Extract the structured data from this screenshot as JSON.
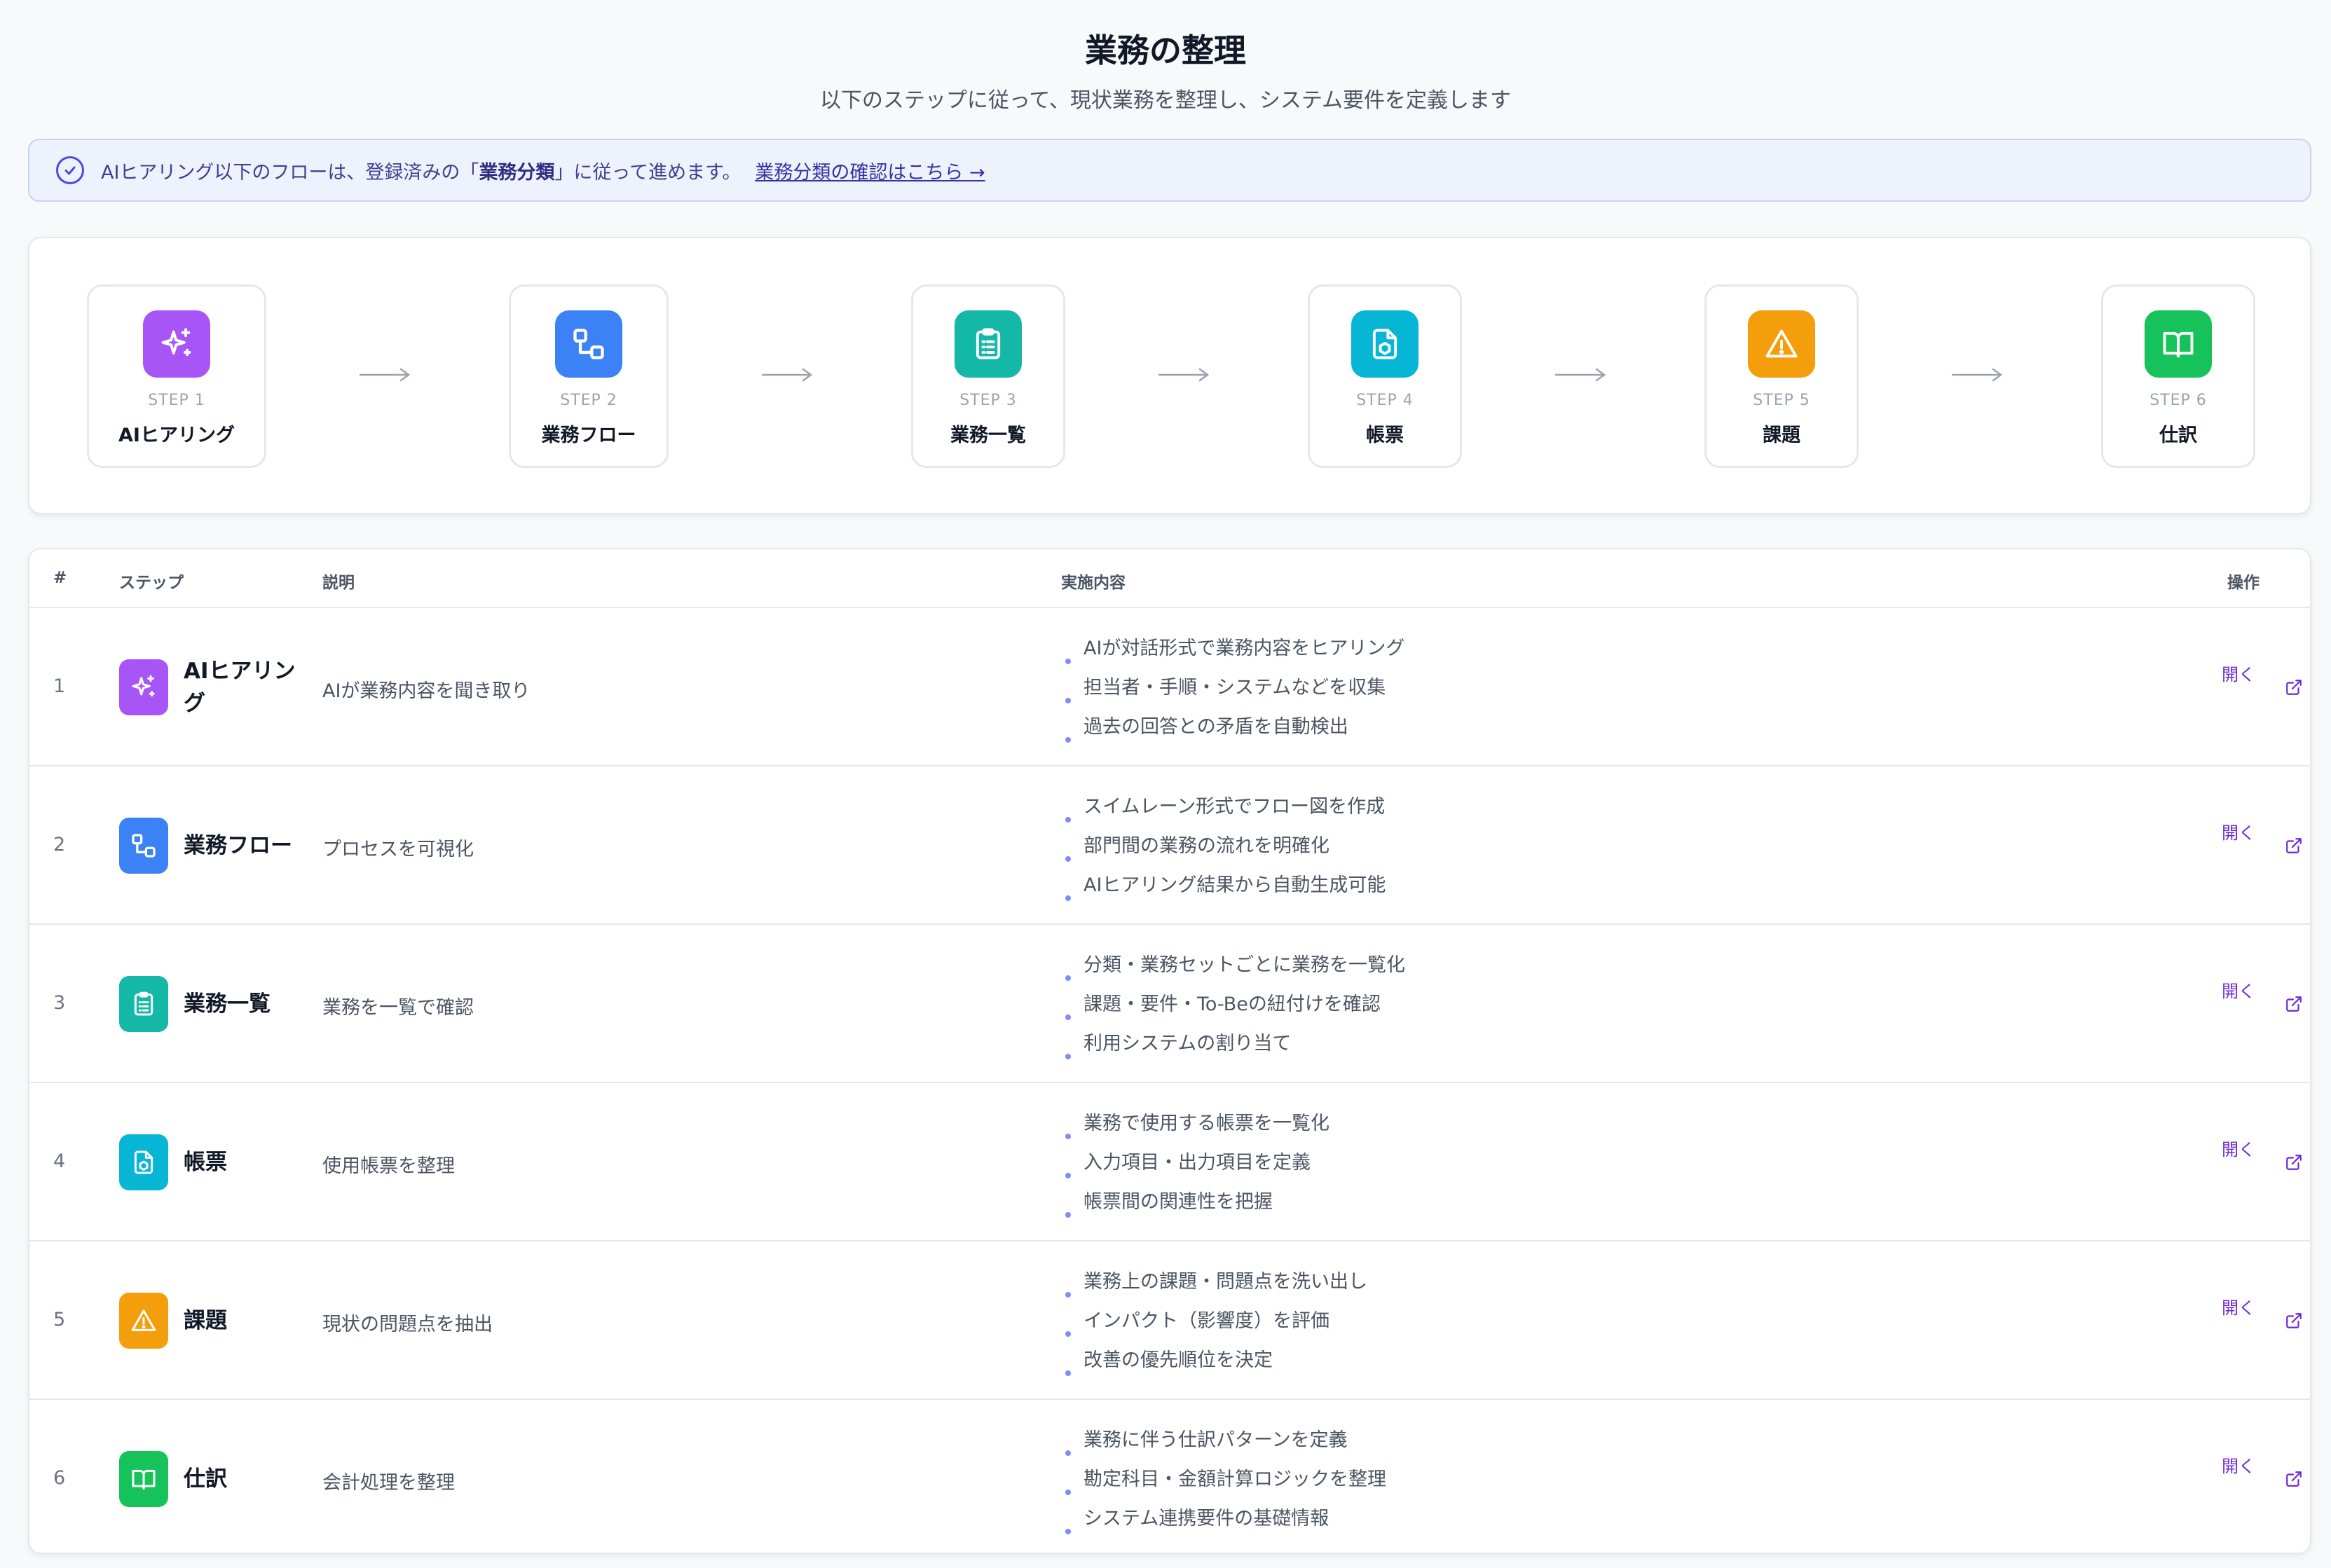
{
  "header": {
    "title": "業務の整理",
    "subtitle": "以下のステップに従って、現状業務を整理し、システム要件を定義します"
  },
  "notice": {
    "icon": "check-circle-icon",
    "text_before": "AIヒアリング以下のフローは、登録済みの「",
    "text_strong": "業務分類",
    "text_after": "」に従って進めます。",
    "link_label": "業務分類の確認はこちら →"
  },
  "steps": [
    {
      "num": "STEP 1",
      "name": "AIヒアリング",
      "icon": "sparkles-icon",
      "color": "#a855f7"
    },
    {
      "num": "STEP 2",
      "name": "業務フロー",
      "icon": "flow-icon",
      "color": "#3b82f6"
    },
    {
      "num": "STEP 3",
      "name": "業務一覧",
      "icon": "clipboard-list-icon",
      "color": "#14b8a6"
    },
    {
      "num": "STEP 4",
      "name": "帳票",
      "icon": "document-box-icon",
      "color": "#06b6d4"
    },
    {
      "num": "STEP 5",
      "name": "課題",
      "icon": "warning-icon",
      "color": "#f59e0b"
    },
    {
      "num": "STEP 6",
      "name": "仕訳",
      "icon": "book-open-icon",
      "color": "#16c25a"
    }
  ],
  "table": {
    "headers": {
      "num": "#",
      "step": "ステップ",
      "desc": "説明",
      "content": "実施内容",
      "action": "操作"
    },
    "rows": [
      {
        "num": "1",
        "name": "AIヒアリング",
        "desc": "AIが業務内容を聞き取り",
        "items": [
          "AIが対話形式で業務内容をヒアリング",
          "担当者・手順・システムなどを収集",
          "過去の回答との矛盾を自動検出"
        ],
        "action": "開く"
      },
      {
        "num": "2",
        "name": "業務フロー",
        "desc": "プロセスを可視化",
        "items": [
          "スイムレーン形式でフロー図を作成",
          "部門間の業務の流れを明確化",
          "AIヒアリング結果から自動生成可能"
        ],
        "action": "開く"
      },
      {
        "num": "3",
        "name": "業務一覧",
        "desc": "業務を一覧で確認",
        "items": [
          "分類・業務セットごとに業務を一覧化",
          "課題・要件・To-Beの紐付けを確認",
          "利用システムの割り当て"
        ],
        "action": "開く"
      },
      {
        "num": "4",
        "name": "帳票",
        "desc": "使用帳票を整理",
        "items": [
          "業務で使用する帳票を一覧化",
          "入力項目・出力項目を定義",
          "帳票間の関連性を把握"
        ],
        "action": "開く"
      },
      {
        "num": "5",
        "name": "課題",
        "desc": "現状の問題点を抽出",
        "items": [
          "業務上の課題・問題点を洗い出し",
          "インパクト（影響度）を評価",
          "改善の優先順位を決定"
        ],
        "action": "開く"
      },
      {
        "num": "6",
        "name": "仕訳",
        "desc": "会計処理を整理",
        "items": [
          "業務に伴う仕訳パターンを定義",
          "勘定科目・金額計算ロジックを整理",
          "システム連携要件の基礎情報"
        ],
        "action": "開く"
      }
    ]
  }
}
